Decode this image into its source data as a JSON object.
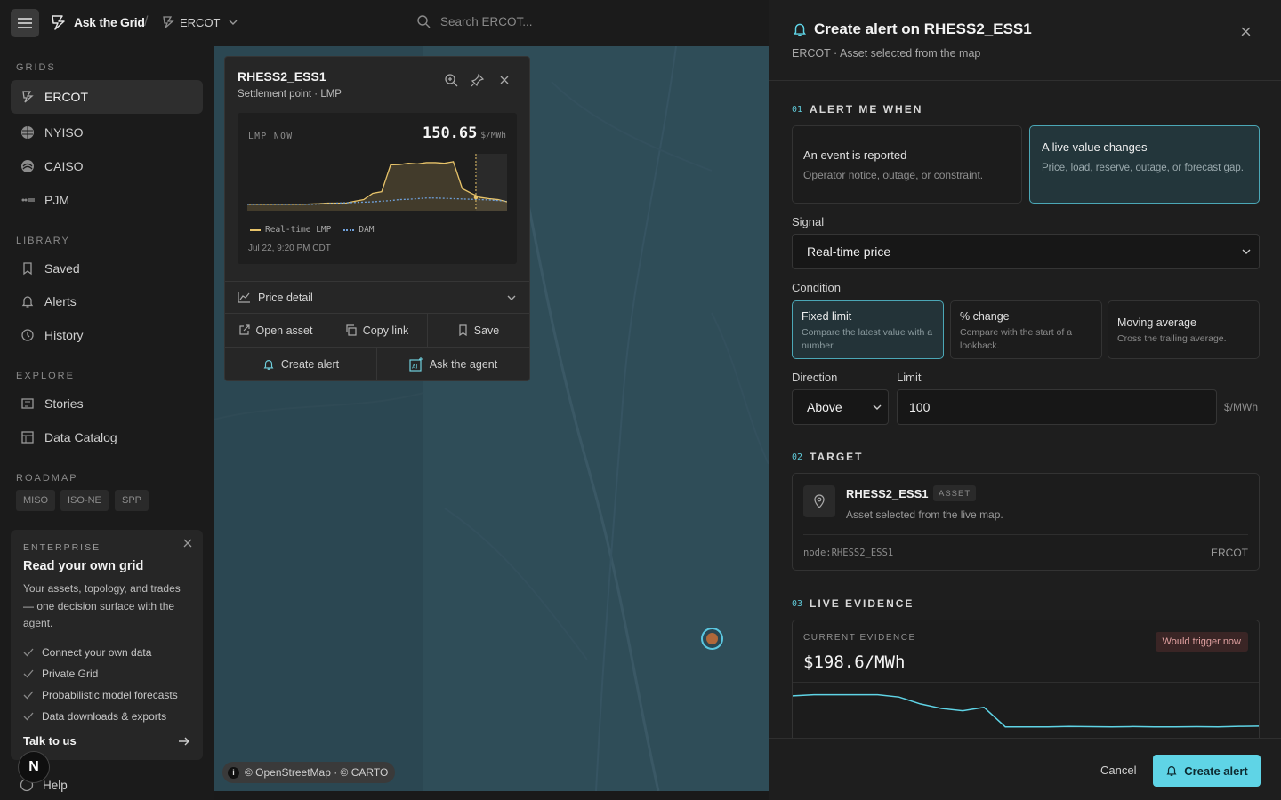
{
  "app": {
    "name": "Ask the Grid",
    "grid": "ERCOT",
    "search_placeholder": "Search ERCOT..."
  },
  "sidebar": {
    "grids_heading": "GRIDS",
    "grids": [
      {
        "label": "ERCOT",
        "icon": "ercot-logo-icon",
        "active": true
      },
      {
        "label": "NYISO",
        "icon": "nyiso-logo-icon"
      },
      {
        "label": "CAISO",
        "icon": "caiso-logo-icon"
      },
      {
        "label": "PJM",
        "icon": "pjm-logo-icon"
      }
    ],
    "library_heading": "LIBRARY",
    "library": [
      {
        "label": "Saved",
        "icon": "bookmark-icon"
      },
      {
        "label": "Alerts",
        "icon": "bell-icon"
      },
      {
        "label": "History",
        "icon": "history-icon"
      }
    ],
    "explore_heading": "EXPLORE",
    "explore": [
      {
        "label": "Stories",
        "icon": "stories-icon"
      },
      {
        "label": "Data Catalog",
        "icon": "catalog-icon"
      }
    ],
    "roadmap_heading": "ROADMAP",
    "roadmap": [
      "MISO",
      "ISO-NE",
      "SPP"
    ],
    "promo": {
      "eyebrow": "ENTERPRISE",
      "title": "Read your own grid",
      "body": "Your assets, topology, and trades — one decision surface with the agent.",
      "features": [
        "Connect your own data",
        "Private Grid",
        "Probabilistic model forecasts",
        "Data downloads & exports"
      ],
      "cta": "Talk to us"
    },
    "help": "Help",
    "avatar_letter": "N"
  },
  "popup": {
    "title": "RHESS2_ESS1",
    "subtitle": "Settlement point · LMP",
    "lmp_label": "LMP NOW",
    "lmp_value": "150.65",
    "lmp_unit": "$/MWh",
    "legend_rt": "Real-time LMP",
    "legend_dam": "DAM",
    "timestamp": "Jul 22, 9:20 PM CDT",
    "price_detail": "Price detail",
    "actions": {
      "open_asset": "Open asset",
      "copy_link": "Copy link",
      "save": "Save",
      "create_alert": "Create alert",
      "ask_agent": "Ask the agent"
    }
  },
  "map": {
    "attribution": "© OpenStreetMap · © CARTO"
  },
  "panel": {
    "title": "Create alert on RHESS2_ESS1",
    "subtitle": "ERCOT · Asset selected from the map",
    "step1": {
      "num": "01",
      "title": "ALERT ME WHEN"
    },
    "alert_types": [
      {
        "title": "An event is reported",
        "desc": "Operator notice, outage, or constraint.",
        "selected": false
      },
      {
        "title": "A live value changes",
        "desc": "Price, load, reserve, outage, or forecast gap.",
        "selected": true
      }
    ],
    "signal_label": "Signal",
    "signal_value": "Real-time price",
    "condition_label": "Condition",
    "conditions": [
      {
        "title": "Fixed limit",
        "desc": "Compare the latest value with a number.",
        "selected": true
      },
      {
        "title": "% change",
        "desc": "Compare with the start of a lookback.",
        "selected": false
      },
      {
        "title": "Moving average",
        "desc": "Cross the trailing average.",
        "selected": false
      }
    ],
    "direction_label": "Direction",
    "direction_value": "Above",
    "limit_label": "Limit",
    "limit_value": "100",
    "limit_unit": "$/MWh",
    "step2": {
      "num": "02",
      "title": "TARGET"
    },
    "target": {
      "name": "RHESS2_ESS1",
      "badge": "ASSET",
      "desc": "Asset selected from the live map.",
      "node": "node:RHESS2_ESS1",
      "grid": "ERCOT"
    },
    "step3": {
      "num": "03",
      "title": "LIVE EVIDENCE"
    },
    "evidence": {
      "label": "CURRENT EVIDENCE",
      "value": "$198.6/MWh",
      "badge": "Would trigger now"
    },
    "cancel": "Cancel",
    "submit": "Create alert"
  },
  "colors": {
    "accent": "#5fd4e6",
    "rt_line": "#e8c46a",
    "dam_line": "#6f9fd8",
    "map_bg": "#2b4752",
    "trigger": "#e0a0a0"
  },
  "chart_data": [
    {
      "type": "line",
      "title": "LMP NOW",
      "series": [
        {
          "name": "Real-time LMP",
          "values": [
            20,
            20,
            20,
            20,
            20,
            20,
            20,
            21,
            22,
            24,
            24,
            24,
            30,
            35,
            55,
            60,
            145,
            146,
            150,
            148,
            152,
            152,
            150,
            155,
            70,
            55,
            42,
            38,
            35,
            28
          ]
        },
        {
          "name": "DAM",
          "values": [
            20,
            20,
            20,
            20,
            20,
            20,
            20,
            20,
            21,
            22,
            24,
            25,
            26,
            27,
            28,
            30,
            32,
            35,
            36,
            38,
            40,
            40,
            39,
            38,
            37,
            36,
            35,
            34,
            32,
            30
          ]
        }
      ],
      "ylim": [
        0,
        180
      ]
    },
    {
      "type": "line",
      "title": "CURRENT EVIDENCE",
      "series": [
        {
          "name": "",
          "values": [
            225,
            226,
            226,
            226,
            226,
            224,
            218,
            214,
            212,
            215,
            198,
            198,
            198,
            198.3,
            198.1,
            198,
            198.2,
            198,
            198,
            198.1,
            198,
            198.4,
            198.6
          ]
        }
      ],
      "ylim": [
        190,
        235
      ]
    }
  ]
}
